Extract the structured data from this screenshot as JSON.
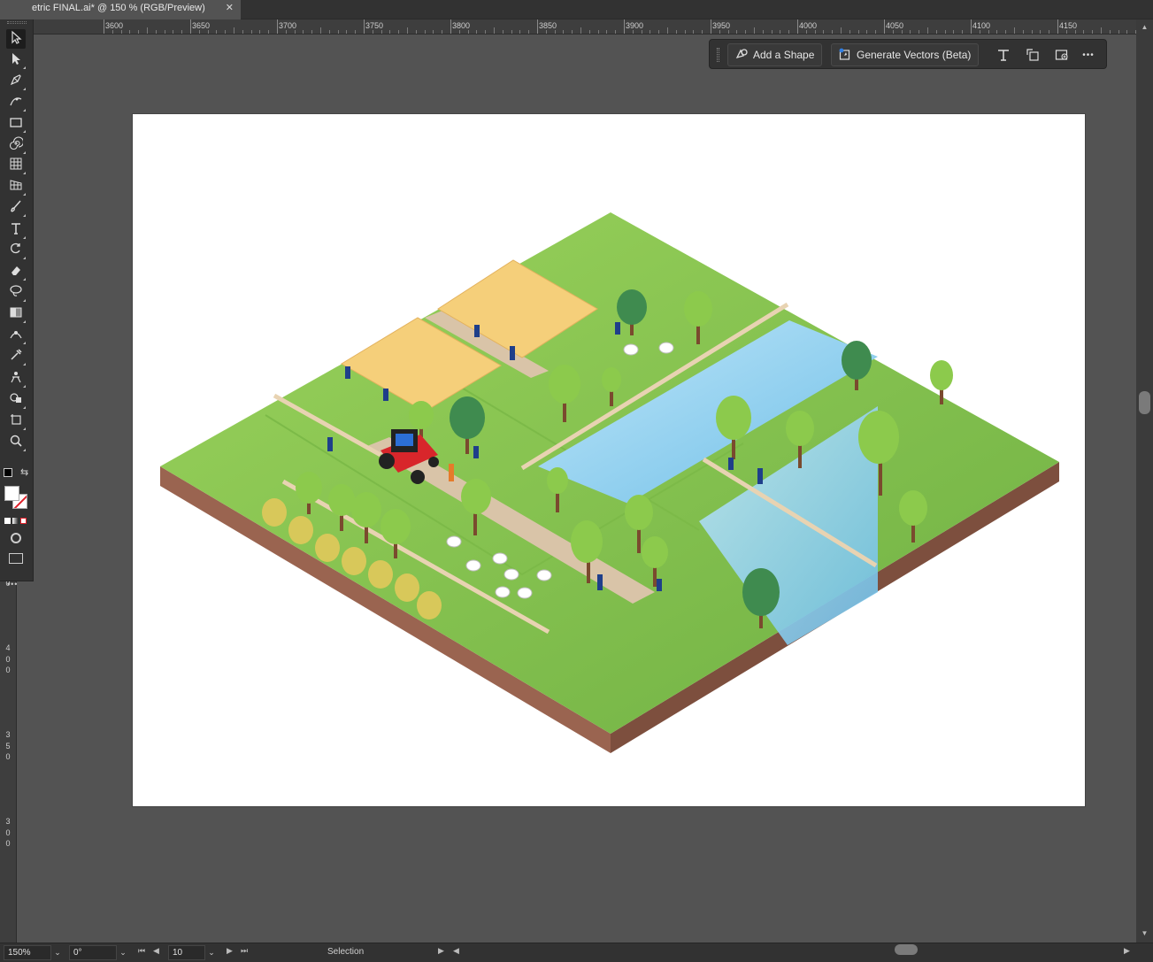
{
  "document_tab": {
    "title": "etric FINAL.ai* @ 150 % (RGB/Preview)",
    "close_glyph": "✕"
  },
  "ruler": {
    "top_labels": [
      "3600",
      "3650",
      "3700",
      "3750",
      "3800",
      "3850",
      "3900",
      "3950",
      "4000",
      "4050",
      "4100",
      "4150"
    ],
    "left_labels": [
      {
        "digits": [
          "4",
          "5",
          "0"
        ]
      },
      {
        "digits": [
          "4",
          "0",
          "0"
        ]
      },
      {
        "digits": [
          "3",
          "5",
          "0"
        ]
      },
      {
        "digits": [
          "3",
          "0",
          "0"
        ]
      }
    ]
  },
  "toolbar": {
    "tools": [
      {
        "name": "selection-tool",
        "icon": "arrow-icon",
        "active": true
      },
      {
        "name": "direct-selection-tool",
        "icon": "white-arrow-icon"
      },
      {
        "name": "pen-tool",
        "icon": "pen-icon"
      },
      {
        "name": "curvature-tool",
        "icon": "curvature-icon"
      },
      {
        "name": "rectangle-tool",
        "icon": "rectangle-icon"
      },
      {
        "name": "spiral-tool",
        "icon": "spiral-icon"
      },
      {
        "name": "grid-tool",
        "icon": "grid-icon"
      },
      {
        "name": "perspective-grid-tool",
        "icon": "perspective-icon"
      },
      {
        "name": "paintbrush-tool",
        "icon": "brush-icon"
      },
      {
        "name": "type-tool",
        "icon": "type-icon"
      },
      {
        "name": "rotate-tool",
        "icon": "rotate-icon"
      },
      {
        "name": "eraser-tool",
        "icon": "eraser-icon"
      },
      {
        "name": "lasso-tool",
        "icon": "lasso-icon"
      },
      {
        "name": "gradient-tool",
        "icon": "gradient-icon"
      },
      {
        "name": "width-tool",
        "icon": "width-icon"
      },
      {
        "name": "eyedropper-tool",
        "icon": "eyedropper-icon"
      },
      {
        "name": "puppet-warp-tool",
        "icon": "puppet-icon"
      },
      {
        "name": "shape-builder-tool",
        "icon": "shape-builder-icon"
      },
      {
        "name": "artboard-tool",
        "icon": "artboard-icon"
      },
      {
        "name": "zoom-tool",
        "icon": "zoom-icon"
      }
    ],
    "more_glyph": "•••"
  },
  "taskbar": {
    "add_shape_label": "Add a Shape",
    "generate_vectors_label": "Generate Vectors (Beta)",
    "more_glyph": "•••"
  },
  "statusbar": {
    "zoom": "150%",
    "rotation": "0°",
    "artboard_number": "10",
    "tool_label": "Selection",
    "dropdown_glyph": "⌄"
  },
  "colors": {
    "ui_bg": "#535353",
    "panel": "#323232",
    "grass_light": "#8fcc52",
    "grass_dark": "#6fb043",
    "soil": "#8a5a45",
    "water": "#7ec8ec",
    "hay": "#f5cf7a",
    "tractor": "#d8262b"
  }
}
